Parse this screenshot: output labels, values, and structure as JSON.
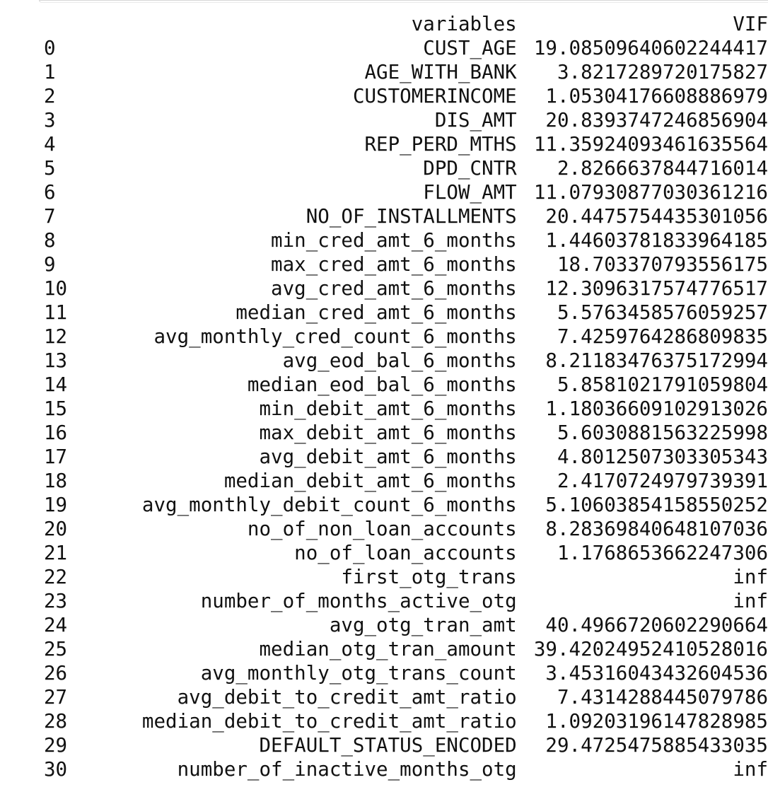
{
  "table": {
    "columns": {
      "index": "",
      "variables": "variables",
      "vif": "VIF"
    },
    "rows": [
      {
        "index": "0",
        "variable": "CUST_AGE",
        "vif": "19.08509640602244417"
      },
      {
        "index": "1",
        "variable": "AGE_WITH_BANK",
        "vif": "3.8217289720175827"
      },
      {
        "index": "2",
        "variable": "CUSTOMERINCOME",
        "vif": "1.05304176608886979"
      },
      {
        "index": "3",
        "variable": "DIS_AMT",
        "vif": "20.8393747246856904"
      },
      {
        "index": "4",
        "variable": "REP_PERD_MTHS",
        "vif": "11.35924093461635564"
      },
      {
        "index": "5",
        "variable": "DPD_CNTR",
        "vif": "2.8266637844716014"
      },
      {
        "index": "6",
        "variable": "FLOW_AMT",
        "vif": "11.07930877030361216"
      },
      {
        "index": "7",
        "variable": "NO_OF_INSTALLMENTS",
        "vif": "20.4475754435301056"
      },
      {
        "index": "8",
        "variable": "min_cred_amt_6_months",
        "vif": "1.44603781833964185"
      },
      {
        "index": "9",
        "variable": "max_cred_amt_6_months",
        "vif": "18.703370793556175"
      },
      {
        "index": "10",
        "variable": "avg_cred_amt_6_months",
        "vif": "12.3096317574776517"
      },
      {
        "index": "11",
        "variable": "median_cred_amt_6_months",
        "vif": "5.5763458576059257"
      },
      {
        "index": "12",
        "variable": "avg_monthly_cred_count_6_months",
        "vif": "7.4259764286809835"
      },
      {
        "index": "13",
        "variable": "avg_eod_bal_6_months",
        "vif": "8.21183476375172994"
      },
      {
        "index": "14",
        "variable": "median_eod_bal_6_months",
        "vif": "5.8581021791059804"
      },
      {
        "index": "15",
        "variable": "min_debit_amt_6_months",
        "vif": "1.18036609102913026"
      },
      {
        "index": "16",
        "variable": "max_debit_amt_6_months",
        "vif": "5.6030881563225998"
      },
      {
        "index": "17",
        "variable": "avg_debit_amt_6_months",
        "vif": "4.8012507303305343"
      },
      {
        "index": "18",
        "variable": "median_debit_amt_6_months",
        "vif": "2.4170724979739391"
      },
      {
        "index": "19",
        "variable": "avg_monthly_debit_count_6_months",
        "vif": "5.10603854158550252"
      },
      {
        "index": "20",
        "variable": "no_of_non_loan_accounts",
        "vif": "8.28369840648107036"
      },
      {
        "index": "21",
        "variable": "no_of_loan_accounts",
        "vif": "1.1768653662247306"
      },
      {
        "index": "22",
        "variable": "first_otg_trans",
        "vif": "inf"
      },
      {
        "index": "23",
        "variable": "number_of_months_active_otg",
        "vif": "inf"
      },
      {
        "index": "24",
        "variable": "avg_otg_tran_amt",
        "vif": "40.4966720602290664"
      },
      {
        "index": "25",
        "variable": "median_otg_tran_amount",
        "vif": "39.42024952410528016"
      },
      {
        "index": "26",
        "variable": "avg_monthly_otg_trans_count",
        "vif": "3.45316043432604536"
      },
      {
        "index": "27",
        "variable": "avg_debit_to_credit_amt_ratio",
        "vif": "7.4314288445079786"
      },
      {
        "index": "28",
        "variable": "median_debit_to_credit_amt_ratio",
        "vif": "1.09203196147828985"
      },
      {
        "index": "29",
        "variable": "DEFAULT_STATUS_ENCODED",
        "vif": "29.4725475885433035"
      },
      {
        "index": "30",
        "variable": "number_of_inactive_months_otg",
        "vif": "inf"
      }
    ]
  }
}
